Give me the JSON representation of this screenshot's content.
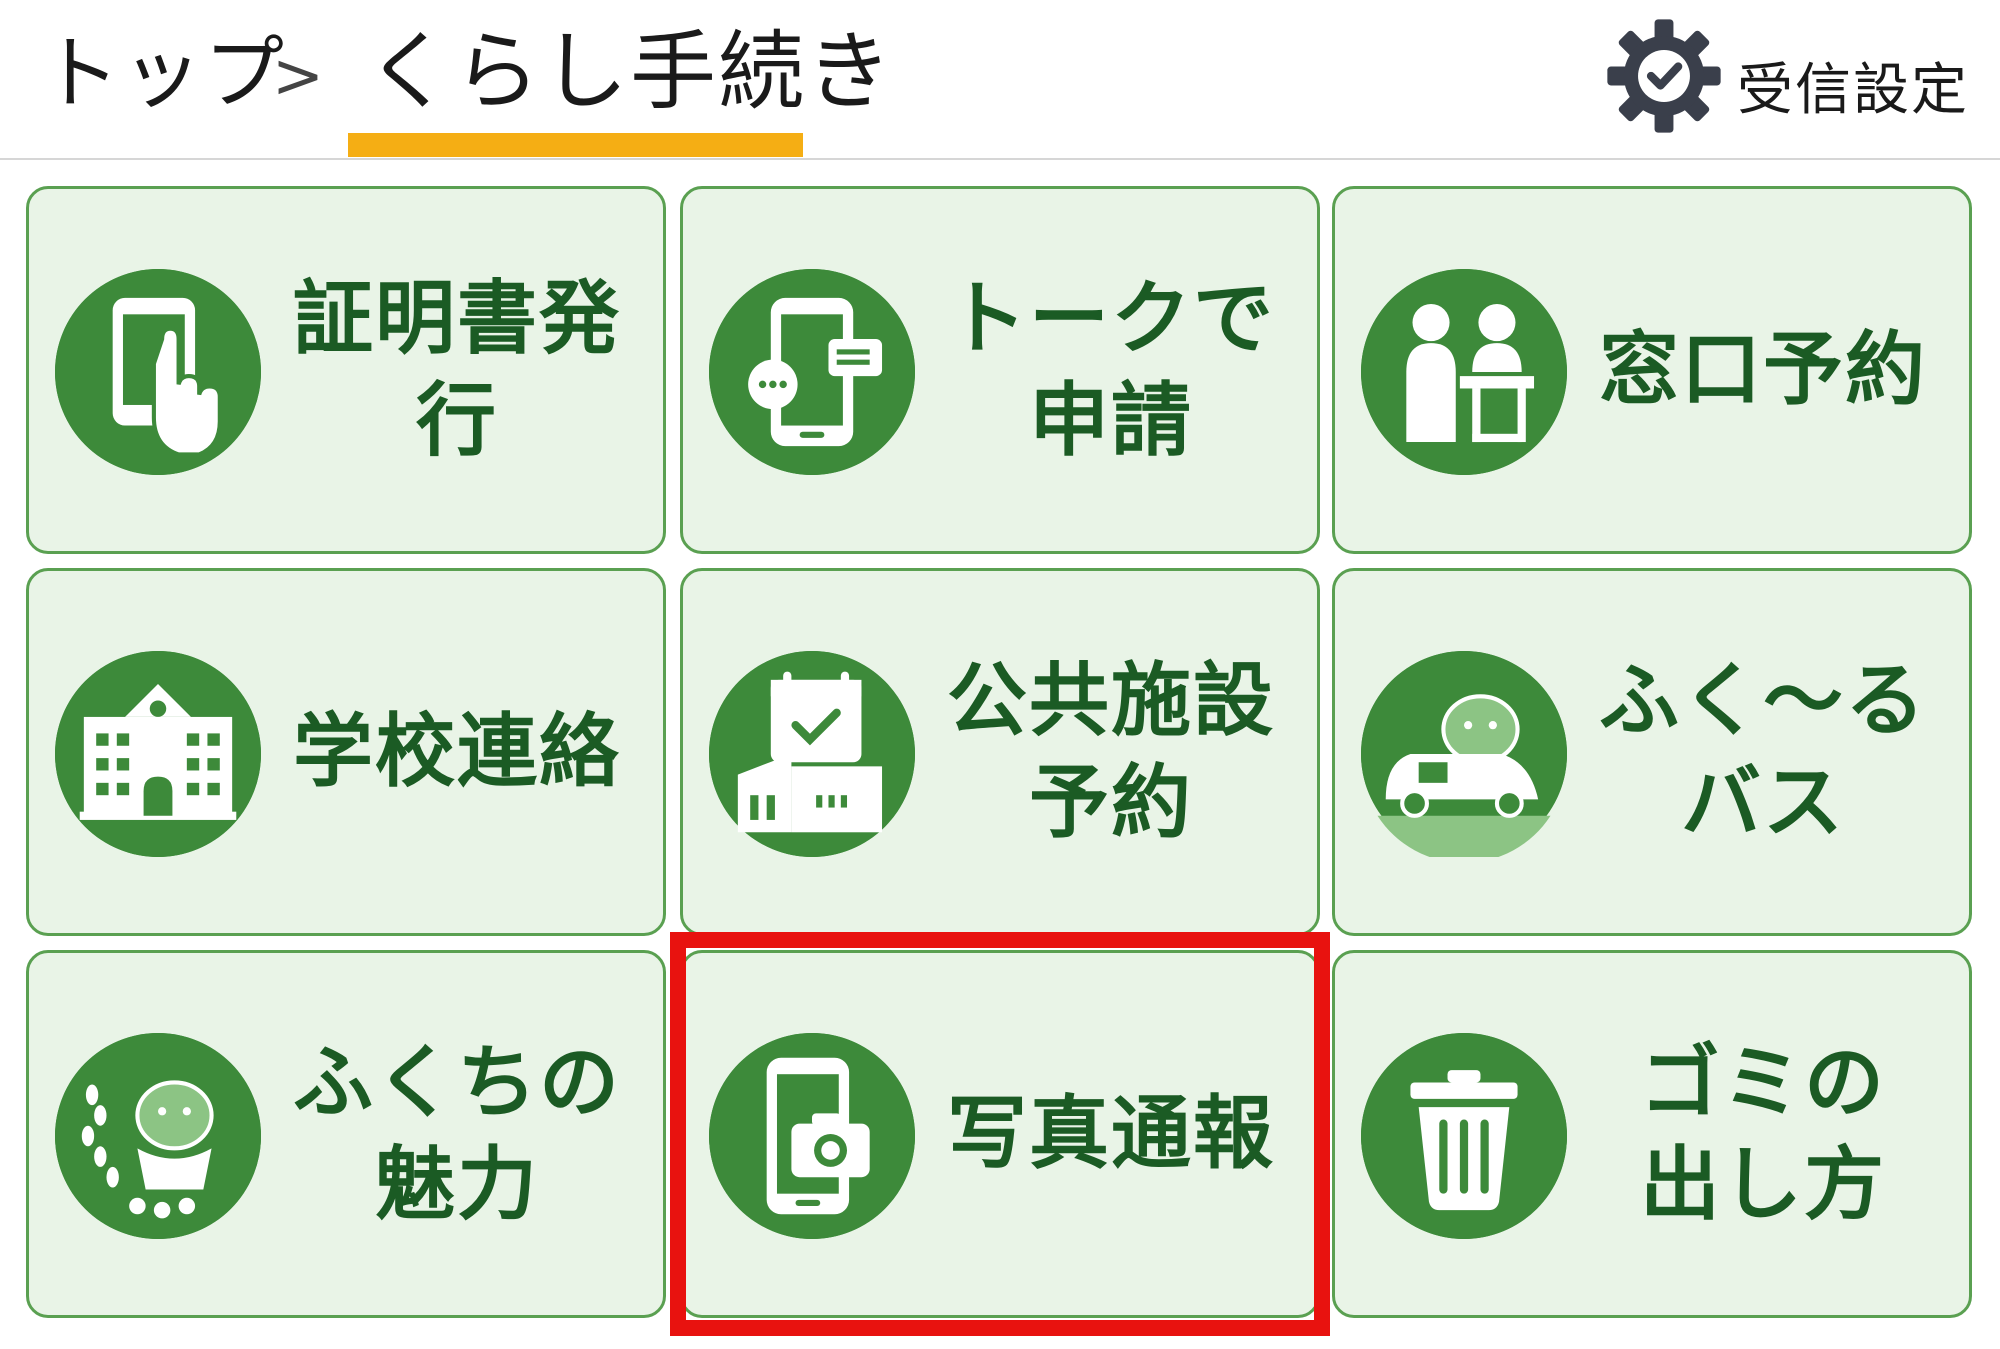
{
  "breadcrumb": {
    "top": "トップ",
    "separator": ">",
    "current": "くらし手続き"
  },
  "settings": {
    "label": "受信設定",
    "icon": "gear-check-icon"
  },
  "tiles": [
    {
      "label": "証明書発行",
      "icon": "smartphone-touch-icon"
    },
    {
      "label": "トークで\n申請",
      "icon": "smartphone-chat-icon"
    },
    {
      "label": "窓口予約",
      "icon": "counter-reception-icon"
    },
    {
      "label": "学校連絡",
      "icon": "school-building-icon"
    },
    {
      "label": "公共施設\n予約",
      "icon": "facility-calendar-icon"
    },
    {
      "label": "ふく〜る\nバス",
      "icon": "bus-mascot-icon"
    },
    {
      "label": "ふくちの\n魅力",
      "icon": "mascot-flowers-icon"
    },
    {
      "label": "写真通報",
      "icon": "smartphone-camera-icon"
    },
    {
      "label": "ゴミの\n出し方",
      "icon": "trash-can-icon"
    }
  ],
  "colors": {
    "tile_bg": "#e9f4e7",
    "tile_border": "#5aa051",
    "icon_circle": "#3d8a3a",
    "label_text": "#1b5b24",
    "breadcrumb_underline": "#f5ae14",
    "highlight": "#e8120f"
  }
}
